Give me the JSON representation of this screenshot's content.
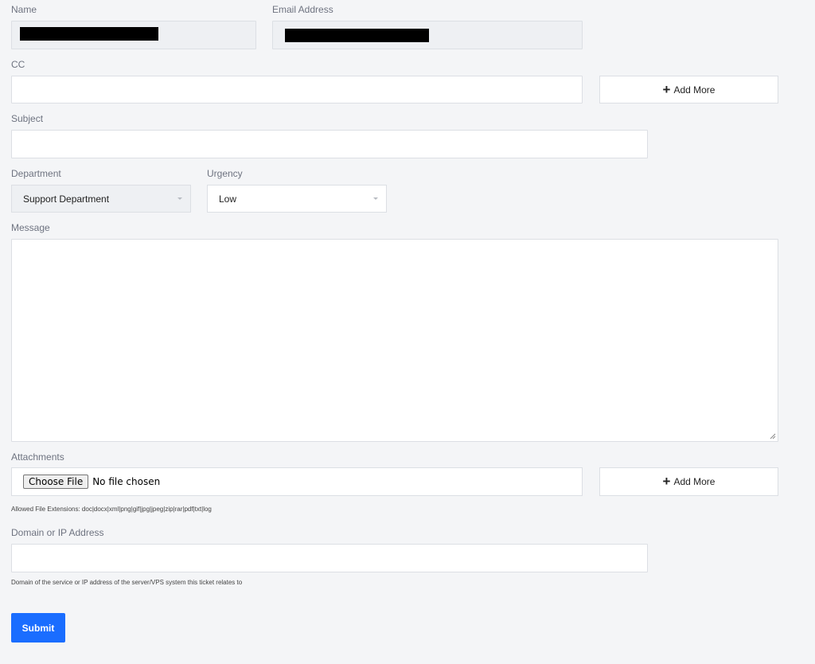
{
  "form": {
    "name": {
      "label": "Name",
      "value": ""
    },
    "email": {
      "label": "Email Address",
      "value": ""
    },
    "cc": {
      "label": "CC",
      "value": "",
      "add_more_label": "Add More"
    },
    "subject": {
      "label": "Subject",
      "value": ""
    },
    "department": {
      "label": "Department",
      "selected": "Support Department"
    },
    "urgency": {
      "label": "Urgency",
      "selected": "Low"
    },
    "message": {
      "label": "Message",
      "value": ""
    },
    "attachments": {
      "label": "Attachments",
      "choose_file_label": "Choose File",
      "status": "No file chosen",
      "add_more_label": "Add More",
      "allowed_text": "Allowed File Extensions: doc|docx|xml|png|gif|jpg|jpeg|zip|rar|pdf|txt|log"
    },
    "domain": {
      "label": "Domain or IP Address",
      "value": "",
      "help": "Domain of the service or IP address of the server/VPS system this ticket relates to"
    },
    "submit_label": "Submit"
  },
  "colors": {
    "background": "#f4f5f7",
    "accent": "#1a6dff",
    "label": "#6e7380"
  }
}
